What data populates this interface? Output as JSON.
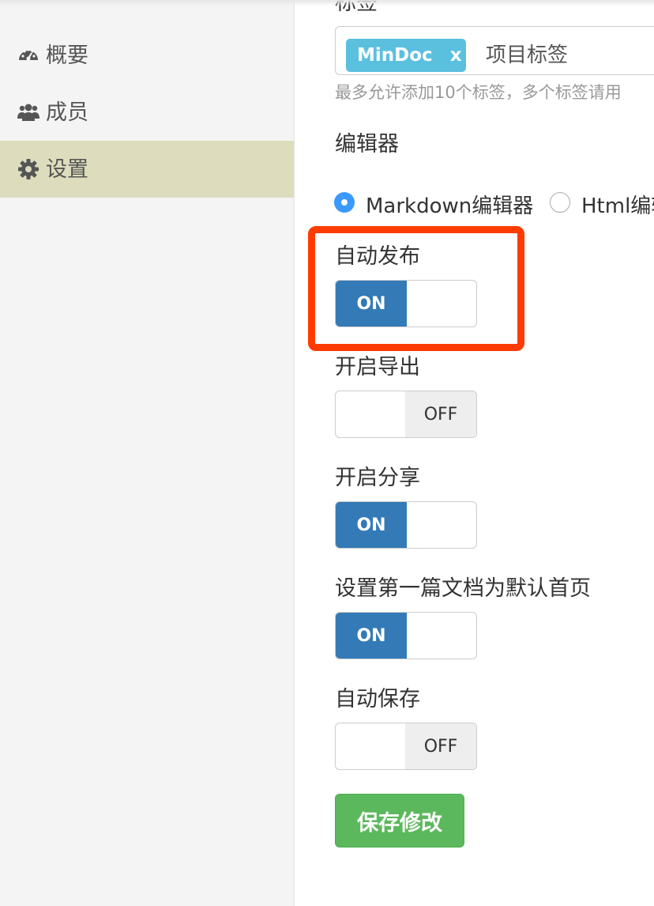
{
  "sidebar": {
    "items": [
      {
        "label": "概要",
        "icon": "dashboard-icon",
        "active": false
      },
      {
        "label": "成员",
        "icon": "users-icon",
        "active": false
      },
      {
        "label": "设置",
        "icon": "gear-icon",
        "active": true
      }
    ]
  },
  "form": {
    "tags_label": "标签",
    "tags": [
      {
        "text": "MinDoc",
        "remove": "x"
      }
    ],
    "tags_placeholder": "项目标签",
    "tags_help": "最多允许添加10个标签，多个标签请用",
    "editor_label": "编辑器",
    "editor_options": [
      {
        "label": "Markdown编辑器",
        "checked": true
      },
      {
        "label": "Html编辑",
        "checked": false
      }
    ],
    "switches": [
      {
        "label": "自动发布",
        "value": "ON",
        "on": true
      },
      {
        "label": "开启导出",
        "value": "OFF",
        "on": false
      },
      {
        "label": "开启分享",
        "value": "ON",
        "on": true
      },
      {
        "label": "设置第一篇文档为默认首页",
        "value": "ON",
        "on": true
      },
      {
        "label": "自动保存",
        "value": "OFF",
        "on": false
      }
    ],
    "save_label": "保存修改"
  },
  "colors": {
    "switch_on": "#337ab7",
    "tag": "#5bc0de",
    "save_button": "#5cb85c",
    "highlight": "#ff3b00",
    "sidebar_active": "#ddddbd"
  }
}
